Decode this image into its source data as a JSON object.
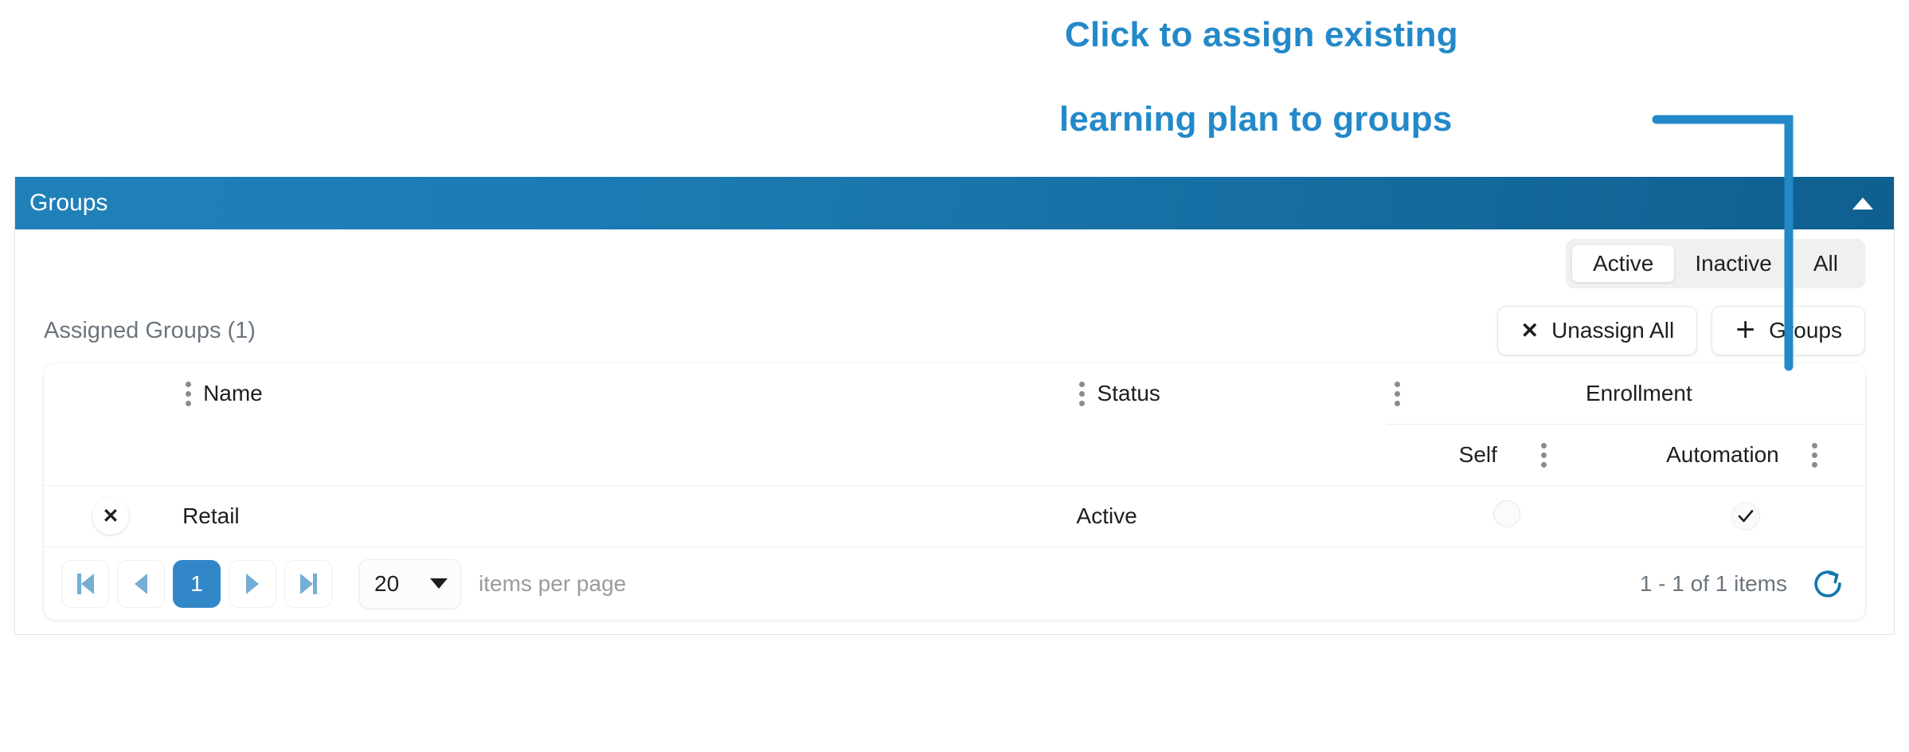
{
  "annotation": {
    "line1": "Click to assign existing",
    "line2": "learning plan to groups",
    "color": "#2389c9"
  },
  "panel": {
    "title": "Groups",
    "collapse_icon": "caret-up-icon",
    "header_gradient_from": "#2081b9",
    "header_gradient_to": "#0f5f90"
  },
  "filter": {
    "options": [
      "Active",
      "Inactive",
      "All"
    ],
    "selected": "Active"
  },
  "toolbar": {
    "assigned_label": "Assigned Groups (1)",
    "unassign_all_label": "Unassign All",
    "unassign_all_glyph": "✕",
    "add_groups_label": "Groups",
    "add_groups_glyph": "＋"
  },
  "grid": {
    "headers": {
      "name": "Name",
      "status": "Status",
      "enrollment": "Enrollment",
      "self": "Self",
      "automation": "Automation"
    },
    "rows": [
      {
        "unassign_glyph": "✕",
        "name": "Retail",
        "status": "Active",
        "self": "",
        "automation": "✓"
      }
    ]
  },
  "pager": {
    "first_label": "first-page",
    "prev_label": "previous-page",
    "current_page": "1",
    "next_label": "next-page",
    "last_label": "last-page",
    "page_size": "20",
    "per_page_label": "items per page",
    "items_count": "1 - 1 of 1 items",
    "refresh_label": "refresh",
    "accent": "#3287c8"
  }
}
